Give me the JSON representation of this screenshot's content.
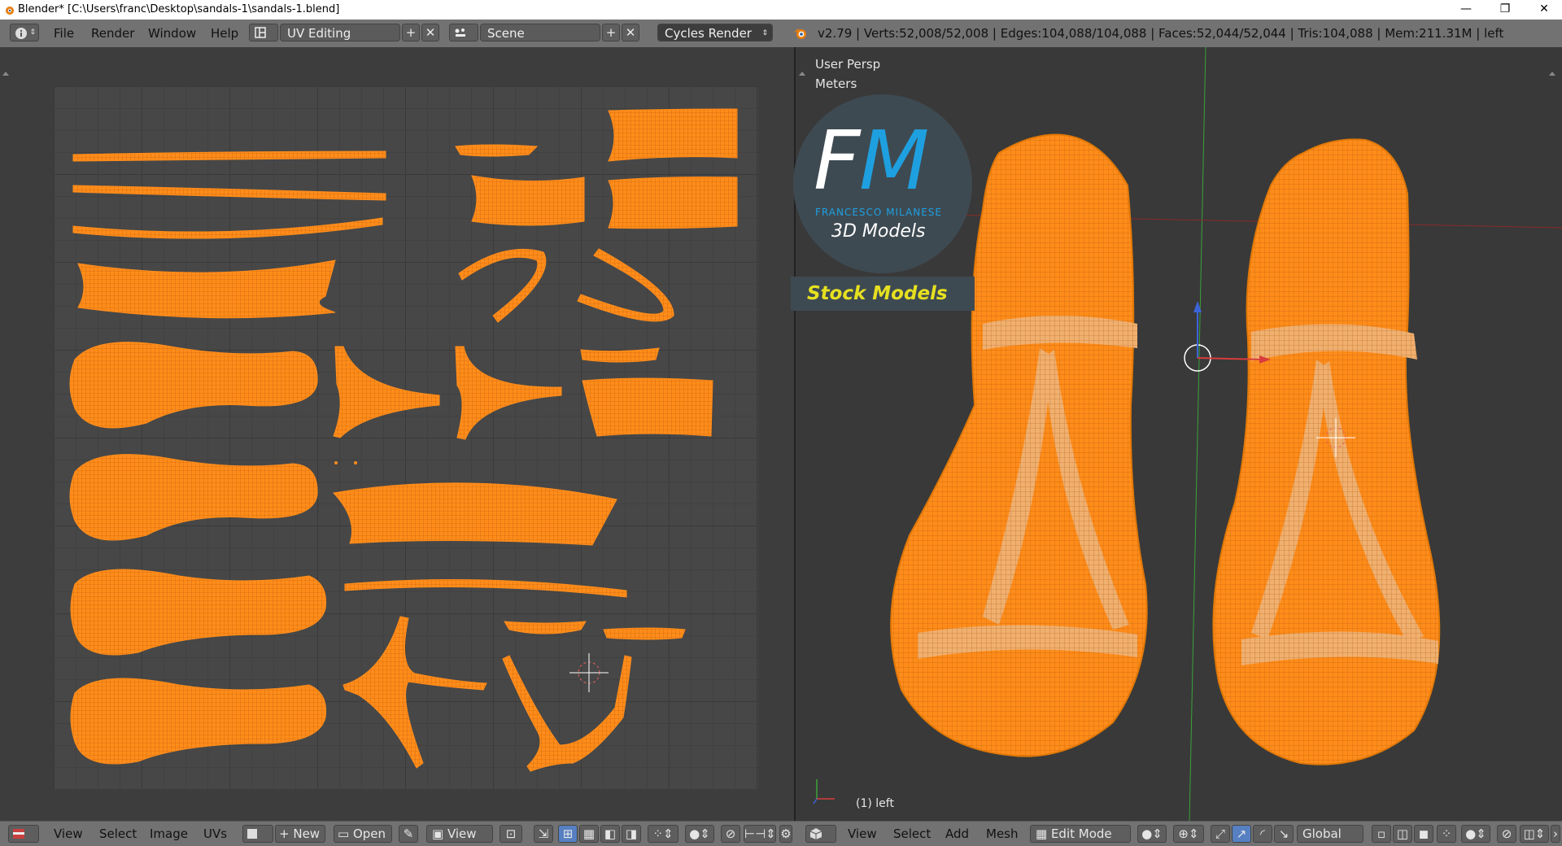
{
  "window": {
    "title": "Blender* [C:\\Users\\franc\\Desktop\\sandals-1\\sandals-1.blend]",
    "minimize_glyph": "—",
    "maximize_glyph": "❐",
    "close_glyph": "✕"
  },
  "top_menu": {
    "items": [
      "File",
      "Render",
      "Window",
      "Help"
    ],
    "layout_name": "UV Editing",
    "scene_name": "Scene",
    "render_engine": "Cycles Render",
    "stats": "v2.79 | Verts:52,008/52,008 | Edges:104,088/104,088 | Faces:52,044/52,044 | Tris:104,088 | Mem:211.31M | left"
  },
  "viewport": {
    "view_label": "User Persp",
    "units_label": "Meters",
    "object_label": "(1) left",
    "mesh_color": "#ff8c1a",
    "logo": {
      "initials_f": "F",
      "initials_m": "M",
      "author": "FRANCESCO MILANESE",
      "tagline": "3D Models",
      "badge": "Stock Models"
    }
  },
  "uv_editor": {
    "island_color": "#ff8c1a",
    "grid_color": "#474747"
  },
  "uv_footer": {
    "menus": [
      "View",
      "Select",
      "Image",
      "UVs"
    ],
    "new_label": "New",
    "open_label": "Open",
    "view_label": "View"
  },
  "view3d_footer": {
    "menus": [
      "View",
      "Select",
      "Add",
      "Mesh"
    ],
    "mode_label": "Edit Mode",
    "orientation_label": "Global"
  },
  "icons": {
    "info": "info-icon",
    "layout": "layout-icon",
    "scene": "scene-icon",
    "blender": "blender-logo-icon"
  }
}
